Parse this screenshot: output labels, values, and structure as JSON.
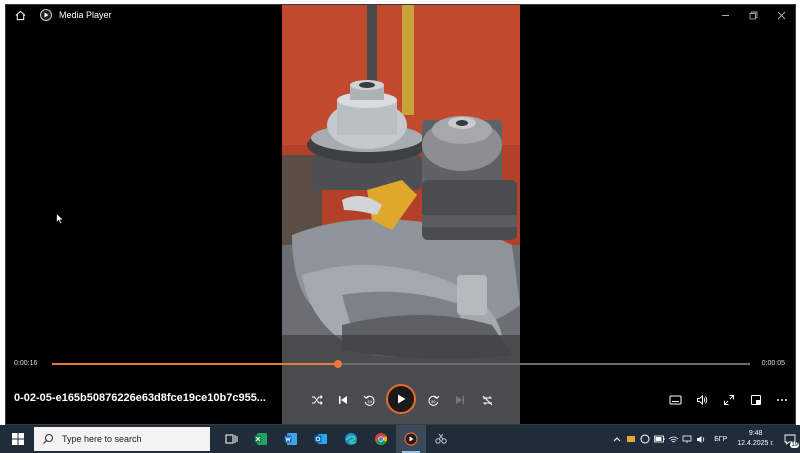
{
  "window": {
    "title": "Media Player"
  },
  "player": {
    "elapsed": "0:00:16",
    "remaining": "0:00:05",
    "progress": 0.41,
    "filename": "0-02-05-e165b50876226e63d8fce19ce10b7c955..."
  },
  "colors": {
    "accent": "#e8793a",
    "taskbar": "#1f2d3a",
    "video_bg": "#b03a24"
  },
  "controls": {
    "shuffle": "shuffle-icon",
    "previous": "previous-icon",
    "skip_back": "skip-back-10-icon",
    "play": "play-icon",
    "skip_forward": "skip-forward-30-icon",
    "next": "next-icon",
    "repeat": "repeat-off-icon",
    "captions": "captions-icon",
    "volume": "volume-icon",
    "fullscreen": "fullscreen-icon",
    "miniplayer": "miniplayer-icon",
    "more": "more-icon"
  },
  "taskbar": {
    "search_placeholder": "Type here to search",
    "language": "БГР",
    "time": "9:48",
    "date": "12.4.2025 г.",
    "notification_count": "19"
  }
}
